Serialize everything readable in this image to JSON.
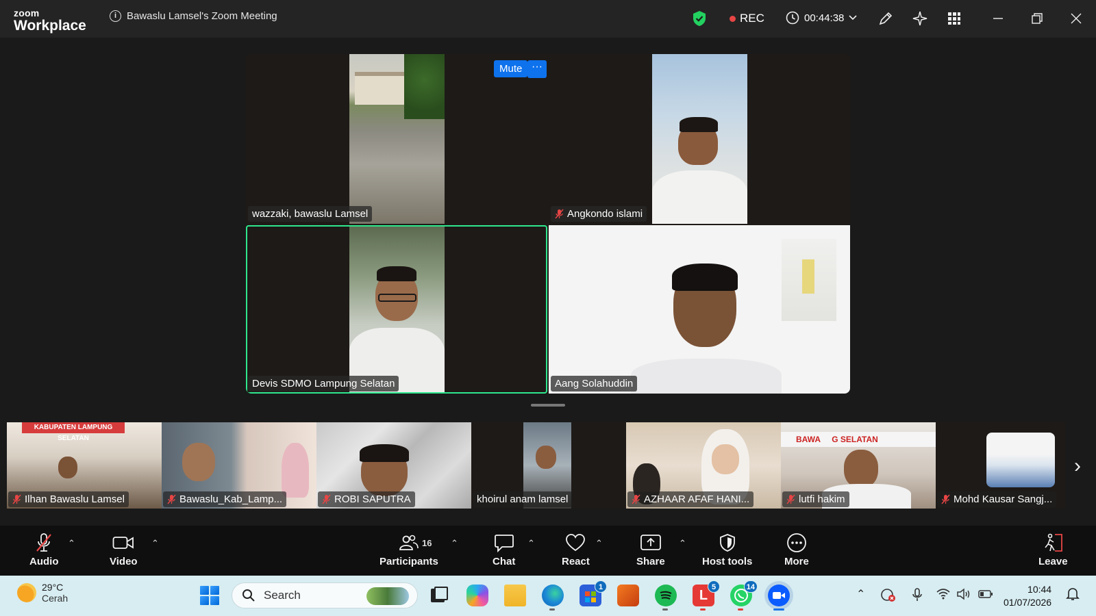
{
  "app": {
    "logo_top": "zoom",
    "logo_bottom": "Workplace",
    "meeting_title": "Bawaslu Lamsel's Zoom Meeting",
    "rec_label": "REC",
    "elapsed": "00:44:38"
  },
  "grid": {
    "mute_label": "Mute",
    "more_label": "···",
    "tiles": [
      {
        "name": "wazzaki, bawaslu Lamsel",
        "muted": false
      },
      {
        "name": "Angkondo islami",
        "muted": true
      },
      {
        "name": "Devis SDMO Lampung Selatan",
        "muted": false,
        "active_speaker": true
      },
      {
        "name": "Aang Solahuddin",
        "muted": false
      }
    ]
  },
  "strip": {
    "participants": [
      {
        "name": "Ilhan Bawaslu Lamsel",
        "muted": true
      },
      {
        "name": "Bawaslu_Kab_Lamp...",
        "muted": true
      },
      {
        "name": "ROBI SAPUTRA",
        "muted": true
      },
      {
        "name": "khoirul anam lamsel",
        "muted": false
      },
      {
        "name": "AZHAAR AFAF HANI...",
        "muted": true
      },
      {
        "name": "lutfi hakim",
        "muted": true
      },
      {
        "name": "Mohd Kausar Sangj...",
        "muted": true
      }
    ],
    "thumb_text": {
      "sign_left": "KABUPATEN LAMPUNG SELATAN",
      "sign_right": "BAWA     G SELATAN"
    }
  },
  "controls": {
    "audio": "Audio",
    "video": "Video",
    "participants": "Participants",
    "participants_count": "16",
    "chat": "Chat",
    "react": "React",
    "share": "Share",
    "host_tools": "Host tools",
    "more": "More",
    "leave": "Leave"
  },
  "taskbar": {
    "temp": "29°C",
    "weather": "Cerah",
    "search_placeholder": "Search",
    "badge_store": "1",
    "badge_l": "5",
    "badge_whatsapp": "14",
    "time": "10:44",
    "date": "01/07/2026"
  }
}
